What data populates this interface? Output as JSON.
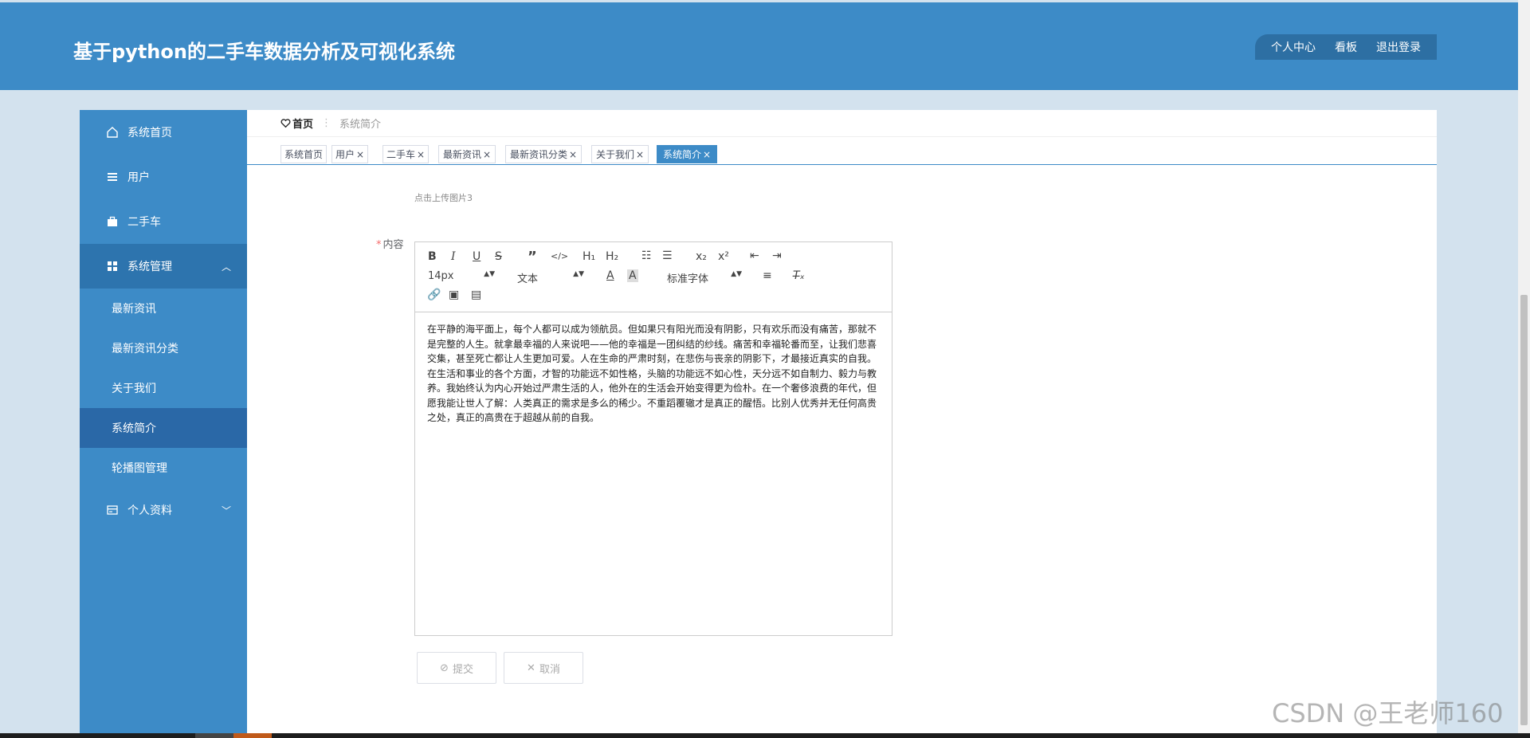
{
  "header": {
    "title": "基于python的二手车数据分析及可视化系统",
    "nav": [
      "个人中心",
      "看板",
      "退出登录"
    ]
  },
  "sidebar": {
    "items": [
      {
        "label": "系统首页",
        "icon": "home-icon"
      },
      {
        "label": "用户",
        "icon": "list-icon"
      },
      {
        "label": "二手车",
        "icon": "briefcase-icon"
      },
      {
        "label": "系统管理",
        "icon": "grid-icon",
        "expanded": true
      },
      {
        "label": "个人资料",
        "icon": "id-card-icon",
        "expanded": false
      }
    ],
    "submenu": [
      "最新资讯",
      "最新资讯分类",
      "关于我们",
      "系统简介",
      "轮播图管理"
    ],
    "active_sub": "系统简介"
  },
  "breadcrumb": {
    "home": "首页",
    "current": "系统简介"
  },
  "tabs": [
    {
      "label": "系统首页",
      "closable": false
    },
    {
      "label": "用户",
      "closable": true
    },
    {
      "label": "二手车",
      "closable": true
    },
    {
      "label": "最新资讯",
      "closable": true
    },
    {
      "label": "最新资讯分类",
      "closable": true
    },
    {
      "label": "关于我们",
      "closable": true
    },
    {
      "label": "系统简介",
      "closable": true,
      "active": true
    }
  ],
  "tab_close_glyph": "×",
  "form": {
    "upload_hint": "点击上传图片3",
    "content_label": "内容",
    "required_mark": "*"
  },
  "editor": {
    "font_size": "14px",
    "block_type": "文本",
    "font_family": "标准字体",
    "text": "在平静的海平面上，每个人都可以成为领航员。但如果只有阳光而没有阴影，只有欢乐而没有痛苦，那就不是完整的人生。就拿最幸福的人来说吧——他的幸福是一团纠结的纱线。痛苦和幸福轮番而至，让我们悲喜交集，甚至死亡都让人生更加可爱。人在生命的严肃时刻，在悲伤与丧亲的阴影下，才最接近真实的自我。在生活和事业的各个方面，才智的功能远不如性格，头脑的功能远不如心性，天分远不如自制力、毅力与教养。我始终认为内心开始过严肃生活的人，他外在的生活会开始变得更为俭朴。在一个奢侈浪费的年代，但愿我能让世人了解：人类真正的需求是多么的稀少。不重蹈覆辙才是真正的醒悟。比别人优秀并无任何高贵之处，真正的高贵在于超越从前的自我。"
  },
  "buttons": {
    "submit": "提交",
    "cancel": "取消"
  },
  "watermark": "CSDN @王老师160"
}
